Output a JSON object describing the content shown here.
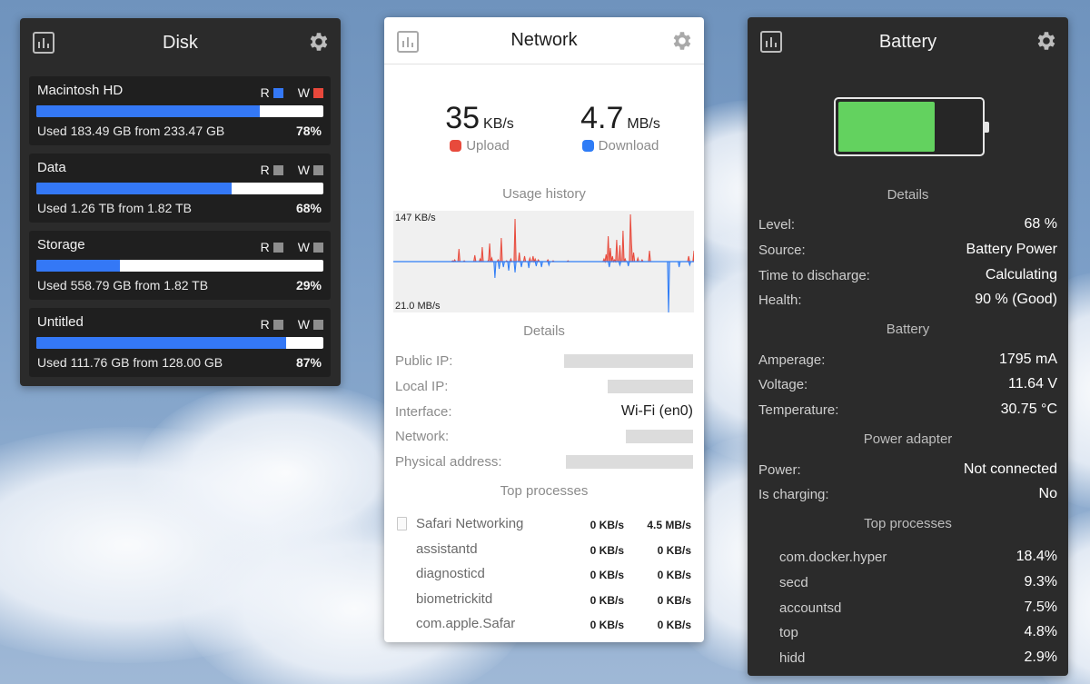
{
  "colors": {
    "accent_blue": "#3478f6",
    "write_red": "#e8483b",
    "inactive_gray": "#8e8e8e",
    "battery_green": "#63d25f",
    "upload_red": "#e84a3c",
    "download_blue": "#2e7cf6"
  },
  "disk": {
    "title": "Disk",
    "read_label": "R",
    "write_label": "W",
    "volumes": [
      {
        "name": "Macintosh HD",
        "used_text": "Used 183.49 GB from 233.47 GB",
        "percent": "78%",
        "fill": 78,
        "read_active": true,
        "write_active": true
      },
      {
        "name": "Data",
        "used_text": "Used 1.26 TB from 1.82 TB",
        "percent": "68%",
        "fill": 68,
        "read_active": false,
        "write_active": false
      },
      {
        "name": "Storage",
        "used_text": "Used 558.79 GB from 1.82 TB",
        "percent": "29%",
        "fill": 29,
        "read_active": false,
        "write_active": false
      },
      {
        "name": "Untitled",
        "used_text": "Used 111.76 GB from 128.00 GB",
        "percent": "87%",
        "fill": 87,
        "read_active": false,
        "write_active": false
      }
    ]
  },
  "network": {
    "title": "Network",
    "upload": {
      "value": "35",
      "unit": "KB/s",
      "label": "Upload"
    },
    "download": {
      "value": "4.7",
      "unit": "MB/s",
      "label": "Download"
    },
    "usage_title": "Usage history",
    "chart_top_label": "147 KB/s",
    "chart_bottom_label": "21.0 MB/s",
    "details_title": "Details",
    "details": [
      {
        "key": "Public IP:",
        "value": "",
        "redacted": true
      },
      {
        "key": "Local IP:",
        "value": "",
        "redacted": true
      },
      {
        "key": "Interface:",
        "value": "Wi-Fi (en0)",
        "redacted": false
      },
      {
        "key": "Network:",
        "value": "",
        "redacted": true
      },
      {
        "key": "Physical address:",
        "value": "",
        "redacted": true
      }
    ],
    "top_title": "Top processes",
    "processes": [
      {
        "name": "Safari Networking",
        "up": "0 KB/s",
        "down": "4.5 MB/s"
      },
      {
        "name": "assistantd",
        "up": "0 KB/s",
        "down": "0 KB/s"
      },
      {
        "name": "diagnosticd",
        "up": "0 KB/s",
        "down": "0 KB/s"
      },
      {
        "name": "biometrickitd",
        "up": "0 KB/s",
        "down": "0 KB/s"
      },
      {
        "name": "com.apple.Safar",
        "up": "0 KB/s",
        "down": "0 KB/s"
      }
    ],
    "upload_history": [
      0,
      0,
      0,
      0,
      0,
      0,
      0,
      0,
      0,
      0,
      0,
      0,
      0,
      0,
      0,
      0,
      0,
      0,
      0,
      0,
      0,
      0,
      0,
      0,
      0,
      0,
      0,
      0,
      0,
      0,
      0,
      0,
      1,
      0,
      2,
      0,
      0,
      0,
      14,
      0,
      0,
      0,
      0,
      1,
      0,
      0,
      0,
      0,
      0,
      0,
      0,
      0,
      0,
      7,
      0,
      0,
      0,
      0,
      3,
      0,
      16,
      0,
      0,
      0,
      0,
      0,
      2,
      20,
      0,
      4,
      0,
      0,
      0,
      0,
      0,
      2,
      0,
      0,
      26,
      0,
      0,
      0,
      0,
      1,
      0,
      0,
      0,
      3,
      0,
      0,
      0,
      47,
      0,
      0,
      0,
      10,
      0,
      0,
      0,
      0,
      6,
      0,
      0,
      0,
      0,
      4,
      0,
      0,
      6,
      0,
      3,
      0,
      0,
      2,
      0,
      0,
      0,
      0,
      0,
      0,
      0,
      0,
      2,
      0,
      0,
      0,
      0,
      1,
      0,
      0,
      0,
      0,
      0,
      0,
      0,
      0,
      0,
      0,
      0,
      0,
      0,
      1,
      0,
      0,
      0,
      0,
      0,
      0,
      0,
      0,
      0,
      0,
      0,
      0,
      0,
      0,
      0,
      0,
      0,
      0,
      0,
      0,
      0,
      0,
      0,
      0,
      0,
      0,
      0,
      0,
      0,
      0,
      0,
      0,
      0,
      0,
      0,
      0,
      0,
      0,
      0,
      3,
      0,
      8,
      0,
      28,
      0,
      15,
      0,
      6,
      0,
      2,
      0,
      24,
      0,
      0,
      18,
      0,
      0,
      34,
      0,
      3,
      0,
      0,
      0,
      0,
      52,
      20,
      0,
      10,
      0,
      0,
      0,
      4,
      0,
      0,
      0,
      2,
      0,
      0,
      0,
      0,
      0,
      0,
      12
    ],
    "download_history": [
      0,
      0,
      0,
      0,
      0,
      0,
      0,
      0,
      0,
      0,
      0,
      0,
      0,
      0,
      0,
      0,
      0,
      0,
      0,
      0,
      0,
      0,
      0,
      0,
      0,
      0,
      0,
      0,
      0,
      0,
      0,
      0,
      0,
      0,
      0,
      0,
      0,
      0,
      0,
      0,
      0,
      0,
      0,
      0,
      0,
      0,
      0,
      0,
      0,
      0,
      0,
      0,
      0,
      0,
      0,
      0,
      0,
      0,
      0,
      0,
      0,
      0,
      0,
      0,
      0,
      0,
      0,
      0,
      0,
      0,
      0,
      0,
      0,
      0,
      0,
      0,
      0,
      0,
      0,
      0,
      0,
      0,
      0,
      0,
      0,
      0,
      0,
      0,
      0,
      0,
      0,
      0,
      0,
      0,
      0,
      0,
      0,
      0,
      0,
      0,
      0,
      0,
      0,
      0,
      0,
      0,
      0,
      0,
      0,
      0,
      0,
      0,
      0,
      0,
      0,
      0,
      0,
      0,
      0,
      0,
      0,
      0,
      0,
      0,
      0,
      0,
      0,
      0,
      0,
      0,
      0,
      0,
      0,
      0,
      0,
      0,
      0,
      0,
      0,
      0,
      0,
      0,
      0,
      0,
      0,
      0,
      0,
      0,
      0,
      0,
      0,
      0,
      0,
      0,
      0,
      0,
      0,
      0,
      0,
      0,
      0,
      0,
      0,
      0,
      0,
      0,
      0,
      0,
      0,
      0,
      0,
      0,
      0,
      0,
      0,
      0,
      0,
      0,
      0,
      0,
      0,
      0,
      0,
      0,
      0,
      0,
      0,
      0,
      0,
      0,
      0,
      0,
      0,
      0,
      0,
      0,
      0,
      0,
      0,
      0,
      0,
      0,
      0,
      0,
      0,
      0,
      0,
      0,
      0,
      0,
      0,
      0,
      0,
      0,
      0,
      0,
      0,
      0,
      0,
      0,
      0,
      0,
      0,
      0,
      0,
      0,
      0,
      0,
      0,
      0,
      0,
      0,
      0,
      0,
      0,
      0,
      0
    ]
  },
  "battery": {
    "title": "Battery",
    "level_fraction": 0.68,
    "details_title": "Details",
    "details": [
      {
        "key": "Level:",
        "value": "68 %"
      },
      {
        "key": "Source:",
        "value": "Battery Power"
      },
      {
        "key": "Time to discharge:",
        "value": "Calculating"
      },
      {
        "key": "Health:",
        "value": "90 % (Good)"
      }
    ],
    "battery_title": "Battery",
    "battery_rows": [
      {
        "key": "Amperage:",
        "value": "1795 mA"
      },
      {
        "key": "Voltage:",
        "value": "11.64 V"
      },
      {
        "key": "Temperature:",
        "value": "30.75 °C"
      }
    ],
    "adapter_title": "Power adapter",
    "adapter_rows": [
      {
        "key": "Power:",
        "value": "Not connected"
      },
      {
        "key": "Is charging:",
        "value": "No"
      }
    ],
    "top_title": "Top processes",
    "processes": [
      {
        "name": "com.docker.hyper",
        "value": "18.4%"
      },
      {
        "name": "secd",
        "value": "9.3%"
      },
      {
        "name": "accountsd",
        "value": "7.5%"
      },
      {
        "name": "top",
        "value": "4.8%"
      },
      {
        "name": "hidd",
        "value": "2.9%"
      }
    ]
  }
}
